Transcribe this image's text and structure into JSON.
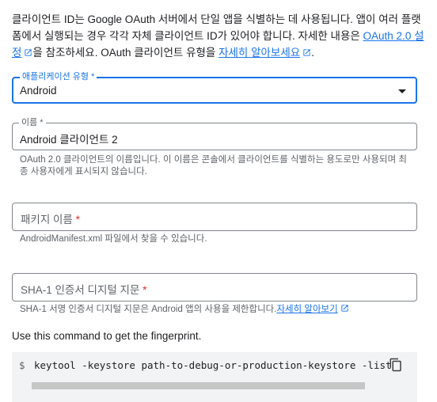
{
  "intro": {
    "text1": "클라이언트 ID는 Google OAuth 서버에서 단일 앱을 식별하는 데 사용됩니다. 앱이 여러 플랫폼에서 실행되는 경우 각각 자체 클라이언트 ID가 있어야 합니다. 자세한 내용은 ",
    "link1": "OAuth 2.0 설정",
    "text2": "을 참조하세요. OAuth 클라이언트 유형을 ",
    "link2": "자세히 알아보세요",
    "text3": "."
  },
  "app_type": {
    "label": "애플리케이션 유형 *",
    "value": "Android"
  },
  "name": {
    "label": "이름 *",
    "value": "Android 클라이언트 2",
    "helper": "OAuth 2.0 클라이언트의 이름입니다. 이 이름은 콘솔에서 클라이언트를 식별하는 용도로만 사용되며 최종 사용자에게 표시되지 않습니다."
  },
  "package": {
    "label": "패키지 이름",
    "required_mark": "*",
    "helper": "AndroidManifest.xml 파일에서 찾을 수 있습니다."
  },
  "sha1": {
    "label": "SHA-1 인증서 디지털 지문",
    "required_mark": "*",
    "helper": "SHA-1 서명 인증서 디지털 지문은 Android 앱의 사용을 제한합니다.",
    "link": "자세히 알아보기"
  },
  "command": {
    "label": "Use this command to get the fingerprint.",
    "prompt": "$",
    "code": "keytool -keystore path-to-debug-or-production-keystore -list"
  },
  "icons": {
    "external": "external-link-icon",
    "copy": "copy-icon",
    "dropdown": "dropdown-arrow-icon"
  },
  "colors": {
    "accent": "#1a73e8",
    "required": "#d93025",
    "code_bg": "#f1f3f4"
  }
}
